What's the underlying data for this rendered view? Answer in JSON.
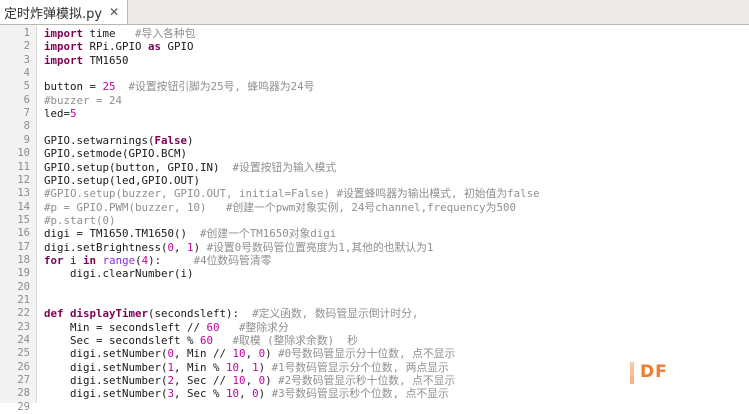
{
  "tab": {
    "title": "定时炸弹模拟.py",
    "close_icon": "close-icon"
  },
  "code_lines": [
    [
      [
        "kw",
        "import"
      ],
      [
        "t",
        " time   "
      ],
      [
        "cm",
        "#导入各种包"
      ]
    ],
    [
      [
        "kw",
        "import"
      ],
      [
        "t",
        " RPi.GPIO "
      ],
      [
        "kw",
        "as"
      ],
      [
        "t",
        " GPIO"
      ]
    ],
    [
      [
        "kw",
        "import"
      ],
      [
        "t",
        " TM1650"
      ]
    ],
    [],
    [
      [
        "t",
        "button = "
      ],
      [
        "num",
        "25"
      ],
      [
        "t",
        "  "
      ],
      [
        "cm",
        "#设置按钮引脚为25号, 蜂鸣器为24号"
      ]
    ],
    [
      [
        "cm",
        "#buzzer = 24"
      ]
    ],
    [
      [
        "t",
        "led="
      ],
      [
        "num",
        "5"
      ]
    ],
    [],
    [
      [
        "t",
        "GPIO.setwarnings("
      ],
      [
        "kw",
        "False"
      ],
      [
        "t",
        ")"
      ]
    ],
    [
      [
        "t",
        "GPIO.setmode(GPIO.BCM)"
      ]
    ],
    [
      [
        "t",
        "GPIO.setup(button, GPIO.IN)  "
      ],
      [
        "cm",
        "#设置按钮为输入模式"
      ]
    ],
    [
      [
        "t",
        "GPIO.setup(led,GPIO.OUT)"
      ]
    ],
    [
      [
        "cm",
        "#GPIO.setup(buzzer, GPIO.OUT, initial=False) #设置蜂鸣器为输出模式, 初始值为false"
      ]
    ],
    [
      [
        "cm",
        "#p = GPIO.PWM(buzzer, 10)   #创建一个pwm对象实例, 24号channel,frequency为500"
      ]
    ],
    [
      [
        "cm",
        "#p.start(0)"
      ]
    ],
    [
      [
        "t",
        "digi = TM1650.TM1650()  "
      ],
      [
        "cm",
        "#创建一个TM1650对象digi"
      ]
    ],
    [
      [
        "t",
        "digi.setBrightness("
      ],
      [
        "num",
        "0"
      ],
      [
        "t",
        ", "
      ],
      [
        "num",
        "1"
      ],
      [
        "t",
        ") "
      ],
      [
        "cm",
        "#设置0号数码管位置亮度为1,其他的也默认为1"
      ]
    ],
    [
      [
        "kw",
        "for"
      ],
      [
        "t",
        " i "
      ],
      [
        "kw",
        "in"
      ],
      [
        "t",
        " "
      ],
      [
        "bi",
        "range"
      ],
      [
        "t",
        "("
      ],
      [
        "num",
        "4"
      ],
      [
        "t",
        "):     "
      ],
      [
        "cm",
        "#4位数码管清零"
      ]
    ],
    [
      [
        "t",
        "    digi.clearNumber(i)"
      ]
    ],
    [],
    [],
    [
      [
        "kw",
        "def"
      ],
      [
        "t",
        " "
      ],
      [
        "fn",
        "displayTimer"
      ],
      [
        "t",
        "(secondsleft):  "
      ],
      [
        "cm",
        "#定义函数, 数码管显示倒计时分,"
      ]
    ],
    [
      [
        "t",
        "    Min = secondsleft // "
      ],
      [
        "num",
        "60"
      ],
      [
        "t",
        "   "
      ],
      [
        "cm",
        "#整除求分"
      ]
    ],
    [
      [
        "t",
        "    Sec = secondsleft % "
      ],
      [
        "num",
        "60"
      ],
      [
        "t",
        "   "
      ],
      [
        "cm",
        "#取模 (整除求余数)  秒"
      ]
    ],
    [
      [
        "t",
        "    digi.setNumber("
      ],
      [
        "num",
        "0"
      ],
      [
        "t",
        ", Min // "
      ],
      [
        "num",
        "10"
      ],
      [
        "t",
        ", "
      ],
      [
        "num",
        "0"
      ],
      [
        "t",
        ") "
      ],
      [
        "cm",
        "#0号数码管显示分十位数, 点不显示"
      ]
    ],
    [
      [
        "t",
        "    digi.setNumber("
      ],
      [
        "num",
        "1"
      ],
      [
        "t",
        ", Min % "
      ],
      [
        "num",
        "10"
      ],
      [
        "t",
        ", "
      ],
      [
        "num",
        "1"
      ],
      [
        "t",
        ") "
      ],
      [
        "cm",
        "#1号数码管显示分个位数, 两点显示"
      ]
    ],
    [
      [
        "t",
        "    digi.setNumber("
      ],
      [
        "num",
        "2"
      ],
      [
        "t",
        ", Sec // "
      ],
      [
        "num",
        "10"
      ],
      [
        "t",
        ", "
      ],
      [
        "num",
        "0"
      ],
      [
        "t",
        ") "
      ],
      [
        "cm",
        "#2号数码管显示秒十位数, 点不显示"
      ]
    ],
    [
      [
        "t",
        "    digi.setNumber("
      ],
      [
        "num",
        "3"
      ],
      [
        "t",
        ", Sec % "
      ],
      [
        "num",
        "10"
      ],
      [
        "t",
        ", "
      ],
      [
        "num",
        "0"
      ],
      [
        "t",
        ") "
      ],
      [
        "cm",
        "#3号数码管显示秒个位数, 点不显示"
      ]
    ],
    []
  ],
  "watermark": "DF"
}
